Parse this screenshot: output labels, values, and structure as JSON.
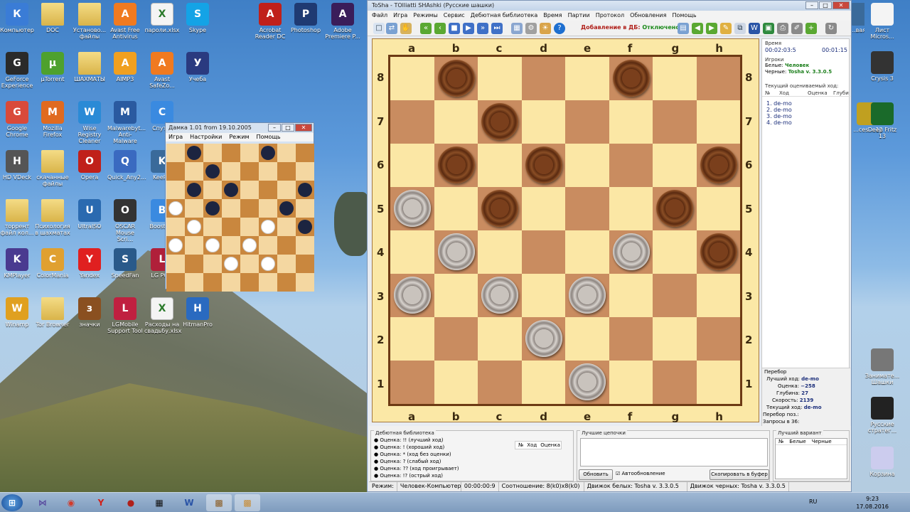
{
  "desktop": {
    "icons": [
      {
        "label": "Компьютер",
        "kind": "pc",
        "icon": "computer-icon"
      },
      {
        "label": "DOC",
        "kind": "folder",
        "icon": "folder-icon"
      },
      {
        "label": "Установо... файлы",
        "kind": "folder",
        "icon": "folder-icon"
      },
      {
        "label": "Avast Free Antivirus",
        "kind": "avast",
        "icon": "avast-icon"
      },
      {
        "label": "пароли.xlsx",
        "kind": "doc",
        "icon": "excel-file-icon"
      },
      {
        "label": "Skype",
        "kind": "skype",
        "icon": "skype-icon"
      },
      {
        "label": "Acrobat Reader DC",
        "kind": "acrobat",
        "icon": "acrobat-icon"
      },
      {
        "label": "Photoshop",
        "kind": "ps",
        "icon": "photoshop-icon"
      },
      {
        "label": "Adobe Premiere P...",
        "kind": "pr",
        "icon": "premiere-icon"
      },
      {
        "label": "GeForce Experience",
        "kind": "nv",
        "icon": "geforce-icon"
      },
      {
        "label": "µTorrent",
        "kind": "ut",
        "icon": "utorrent-icon"
      },
      {
        "label": "ШАХМАТЫ",
        "kind": "folder",
        "icon": "folder-icon"
      },
      {
        "label": "AIMP3",
        "kind": "aimp",
        "icon": "aimp-icon"
      },
      {
        "label": "Avast SafeZo...",
        "kind": "avast",
        "icon": "avast-safezone-icon"
      },
      {
        "label": "Учеба",
        "kind": "book",
        "icon": "book-icon"
      },
      {
        "label": "Google Chrome",
        "kind": "chrome",
        "icon": "chrome-icon"
      },
      {
        "label": "Mozilla Firefox",
        "kind": "ff",
        "icon": "firefox-icon"
      },
      {
        "label": "Wise Registry Cleaner",
        "kind": "wise",
        "icon": "wise-registry-icon"
      },
      {
        "label": "Malwarebyt... Anti-Malware",
        "kind": "mb",
        "icon": "malwarebytes-icon"
      },
      {
        "label": "Спут...",
        "kind": "sput",
        "icon": "sputnik-icon"
      },
      {
        "label": "HD VDeck",
        "kind": "hd",
        "icon": "hdvdeck-icon"
      },
      {
        "label": "скачанные файлы",
        "kind": "folder",
        "icon": "folder-icon"
      },
      {
        "label": "Opera",
        "kind": "opera",
        "icon": "opera-icon"
      },
      {
        "label": "Quick_Any2...",
        "kind": "q",
        "icon": "quickany-icon"
      },
      {
        "label": "KeeP...",
        "kind": "keep",
        "icon": "keepass-icon"
      },
      {
        "label": "торрент файл кол...",
        "kind": "folder",
        "icon": "folder-icon"
      },
      {
        "label": "Психология в шахматах",
        "kind": "folder",
        "icon": "folder-icon"
      },
      {
        "label": "UltraISO",
        "kind": "iso",
        "icon": "ultraiso-icon"
      },
      {
        "label": "OSCAR Mouse Scri...",
        "kind": "oscar",
        "icon": "oscar-icon"
      },
      {
        "label": "BoostS...",
        "kind": "boost",
        "icon": "boost-icon"
      },
      {
        "label": "KMPlayer",
        "kind": "km",
        "icon": "kmplayer-icon"
      },
      {
        "label": "ColorMania",
        "kind": "cm",
        "icon": "colormania-icon"
      },
      {
        "label": "Yandex",
        "kind": "ya",
        "icon": "yandex-icon"
      },
      {
        "label": "SpeedFan",
        "kind": "sf",
        "icon": "speedfan-icon"
      },
      {
        "label": "LG PC...",
        "kind": "lg",
        "icon": "lgpc-icon"
      },
      {
        "label": "Winamp",
        "kind": "wa",
        "icon": "winamp-icon"
      },
      {
        "label": "Tor Browser",
        "kind": "folder",
        "icon": "tor-icon"
      },
      {
        "label": "значки",
        "kind": "case",
        "icon": "folder-case-icon"
      },
      {
        "label": "LGMobile Support Tool",
        "kind": "lgm",
        "icon": "lgmobile-icon"
      },
      {
        "label": "Расходы на свадьбу.xlsx",
        "kind": "doc",
        "icon": "excel-file-icon"
      },
      {
        "label": "HitmanPro",
        "kind": "hp",
        "icon": "hitmanpro-icon"
      }
    ],
    "right_icons": [
      {
        "label": "...вая",
        "icon": "partial-icon"
      },
      {
        "label": "Лист Micros...",
        "icon": "excel-file-icon"
      },
      {
        "label": "Crysis 3",
        "icon": "crysis-icon"
      },
      {
        "label": "...ces ...12",
        "icon": "partial-icon"
      },
      {
        "label": "Deep Fritz 13",
        "icon": "fritz-icon"
      },
      {
        "label": "Занимате... Шашки",
        "icon": "checkers-icon"
      },
      {
        "label": "Русские стратег...",
        "icon": "russian-strategy-icon"
      },
      {
        "label": "Корзина",
        "icon": "recycle-bin-icon"
      }
    ]
  },
  "damka": {
    "title": "Дамка 1.01 from 19.10.2005",
    "menu": [
      "Игра",
      "Настройки",
      "Режим",
      "Помощь"
    ],
    "pieces": {
      "0": {
        "1": "b",
        "5": "b"
      },
      "1": {
        "2": "b"
      },
      "2": {
        "1": "b",
        "3": "b",
        "7": "b"
      },
      "3": {
        "0": "w",
        "2": "b",
        "6": "b"
      },
      "4": {
        "1": "w",
        "5": "w",
        "7": "b"
      },
      "5": {
        "0": "w",
        "2": "w",
        "4": "w"
      },
      "6": {
        "3": "w",
        "5": "w"
      }
    }
  },
  "tosha": {
    "title": "ToSha - TOlliatti SHAshki (Русские шашки)",
    "menu": [
      "Файл",
      "Игра",
      "Режимы",
      "Сервис",
      "Дебютная библиотека",
      "Время",
      "Партии",
      "Протокол",
      "Обновления",
      "Помощь"
    ],
    "db_label": "Добавление в ДБ:",
    "db_value": "Отключено",
    "files": [
      "a",
      "b",
      "c",
      "d",
      "e",
      "f",
      "g",
      "h"
    ],
    "ranks": [
      "8",
      "7",
      "6",
      "5",
      "4",
      "3",
      "2",
      "1"
    ],
    "board": [
      [
        "",
        "b",
        "",
        "",
        "",
        "b",
        "",
        ""
      ],
      [
        "",
        "",
        "b",
        "",
        "",
        "",
        "",
        ""
      ],
      [
        "",
        "b",
        "",
        "b",
        "",
        "",
        "",
        "b"
      ],
      [
        "w",
        "",
        "b",
        "",
        "",
        "",
        "b",
        ""
      ],
      [
        "",
        "w",
        "",
        "",
        "",
        "w",
        "",
        "b"
      ],
      [
        "w",
        "",
        "w",
        "",
        "w",
        "",
        "",
        ""
      ],
      [
        "",
        "",
        "",
        "w",
        "",
        "",
        "",
        ""
      ],
      [
        "",
        "",
        "",
        "",
        "w",
        "",
        "",
        ""
      ]
    ],
    "right": {
      "time_label": "Время",
      "time_white": "00:02:03:5",
      "time_black": "00:01:15",
      "players_label": "Игроки",
      "white_label": "Белые:",
      "white_player": "Человек",
      "black_label": "Черные:",
      "black_player": "Tosha v. 3.3.0.5",
      "current_label": "Текущий оцениваемый ход:",
      "cols": [
        "№",
        "Ход",
        "Оценка",
        "Глуби"
      ],
      "moves": [
        "1.  de-mo",
        "2.  de-mo",
        "3.  de-mo",
        "4.  de-mo"
      ],
      "search_label": "Перебор",
      "best_label": "Лучший ход:",
      "best": "de-mo",
      "eval_label": "Оценка:",
      "eval": "−258",
      "depth_label": "Глубина:",
      "depth": "27",
      "speed_label": "Скорость:",
      "speed": "2139",
      "cur_label": "Текущий ход:",
      "cur": "de-mo",
      "pos_label": "Перебор поз.:",
      "req_label": "Запросы в 36:"
    },
    "bottom": {
      "debut_title": "Дебютная библиотека",
      "debut_items": [
        "Оценка: !! (лучший ход)",
        "Оценка: ! (хороший ход)",
        "Оценка: * (ход без оценки)",
        "Оценка: ? (слабый ход)",
        "Оценка: ?? (ход проигрывает)",
        "Оценка: !? (острый ход)"
      ],
      "debut_cols": [
        "№",
        "Ход",
        "Оценка"
      ],
      "chains_title": "Лучшие цепочки",
      "refresh": "Обновить",
      "autorefresh": "Автообновление",
      "copy": "Скопировать в буфер",
      "variant_title": "Лучший вариант",
      "variant_cols": [
        "№",
        "Белые",
        "Черные"
      ]
    },
    "status": [
      "Режим:",
      "Человек-Компьютер",
      "00:00:00:9",
      "Соотношение: 8(k0)x8(k0)",
      "Движок белых: Tosha v. 3.3.0.5",
      "Движок черных: Tosha v. 3.3.0.5"
    ]
  },
  "taskbar": {
    "lang": "RU",
    "time": "9:23",
    "date": "17.08.2016"
  },
  "colors": {
    "accent": "#1a2d7a",
    "db_off": "#b0201a",
    "light_square": "#fbe7a5",
    "dark_square": "#c98c60"
  }
}
